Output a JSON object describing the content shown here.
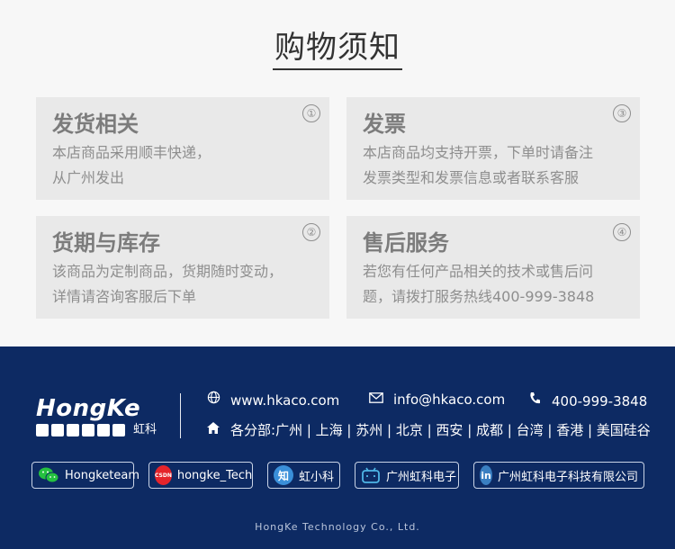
{
  "page_title": "购物须知",
  "cards": [
    {
      "num": "①",
      "title": "发货相关",
      "lines": [
        "本店商品采用顺丰快递，",
        "从广州发出"
      ]
    },
    {
      "num": "③",
      "title": "发票",
      "lines": [
        "本店商品均支持开票，下单时请备注",
        "发票类型和发票信息或者联系客服"
      ]
    },
    {
      "num": "②",
      "title": "货期与库存",
      "lines": [
        "该商品为定制商品，货期随时变动，",
        "详情请咨询客服后下单"
      ]
    },
    {
      "num": "④",
      "title": "售后服务",
      "lines": [
        "若您有任何产品相关的技术或售后问",
        "题，请拨打服务热线400-999-3848"
      ]
    }
  ],
  "footer": {
    "logo_text": "HongKe",
    "logo_cn": "虹科",
    "website": "www.hkaco.com",
    "email": "info@hkaco.com",
    "phone": "400-999-3848",
    "branches_label": "各分部:",
    "branches": "广州 | 上海 | 苏州 | 北京 | 西安 | 成都 | 台湾 | 香港 | 美国硅谷",
    "socials": [
      {
        "icon": "wechat-icon",
        "label": "Hongketeam",
        "badge_text": ""
      },
      {
        "icon": "csdn-icon",
        "label": "hongke_Tech",
        "badge_text": "CSDN"
      },
      {
        "icon": "zhihu-icon",
        "label": "虹小科",
        "badge_text": "知"
      },
      {
        "icon": "bilibili-icon",
        "label": "广州虹科电子",
        "badge_text": ""
      },
      {
        "icon": "linkedin-icon",
        "label": "广州虹科电子科技有限公司",
        "badge_text": "in"
      }
    ],
    "copyright": "HongKe Technology Co., Ltd.",
    "colors": {
      "footer_bg": "#0d2a63",
      "card_bg": "#e9e9e9"
    }
  }
}
